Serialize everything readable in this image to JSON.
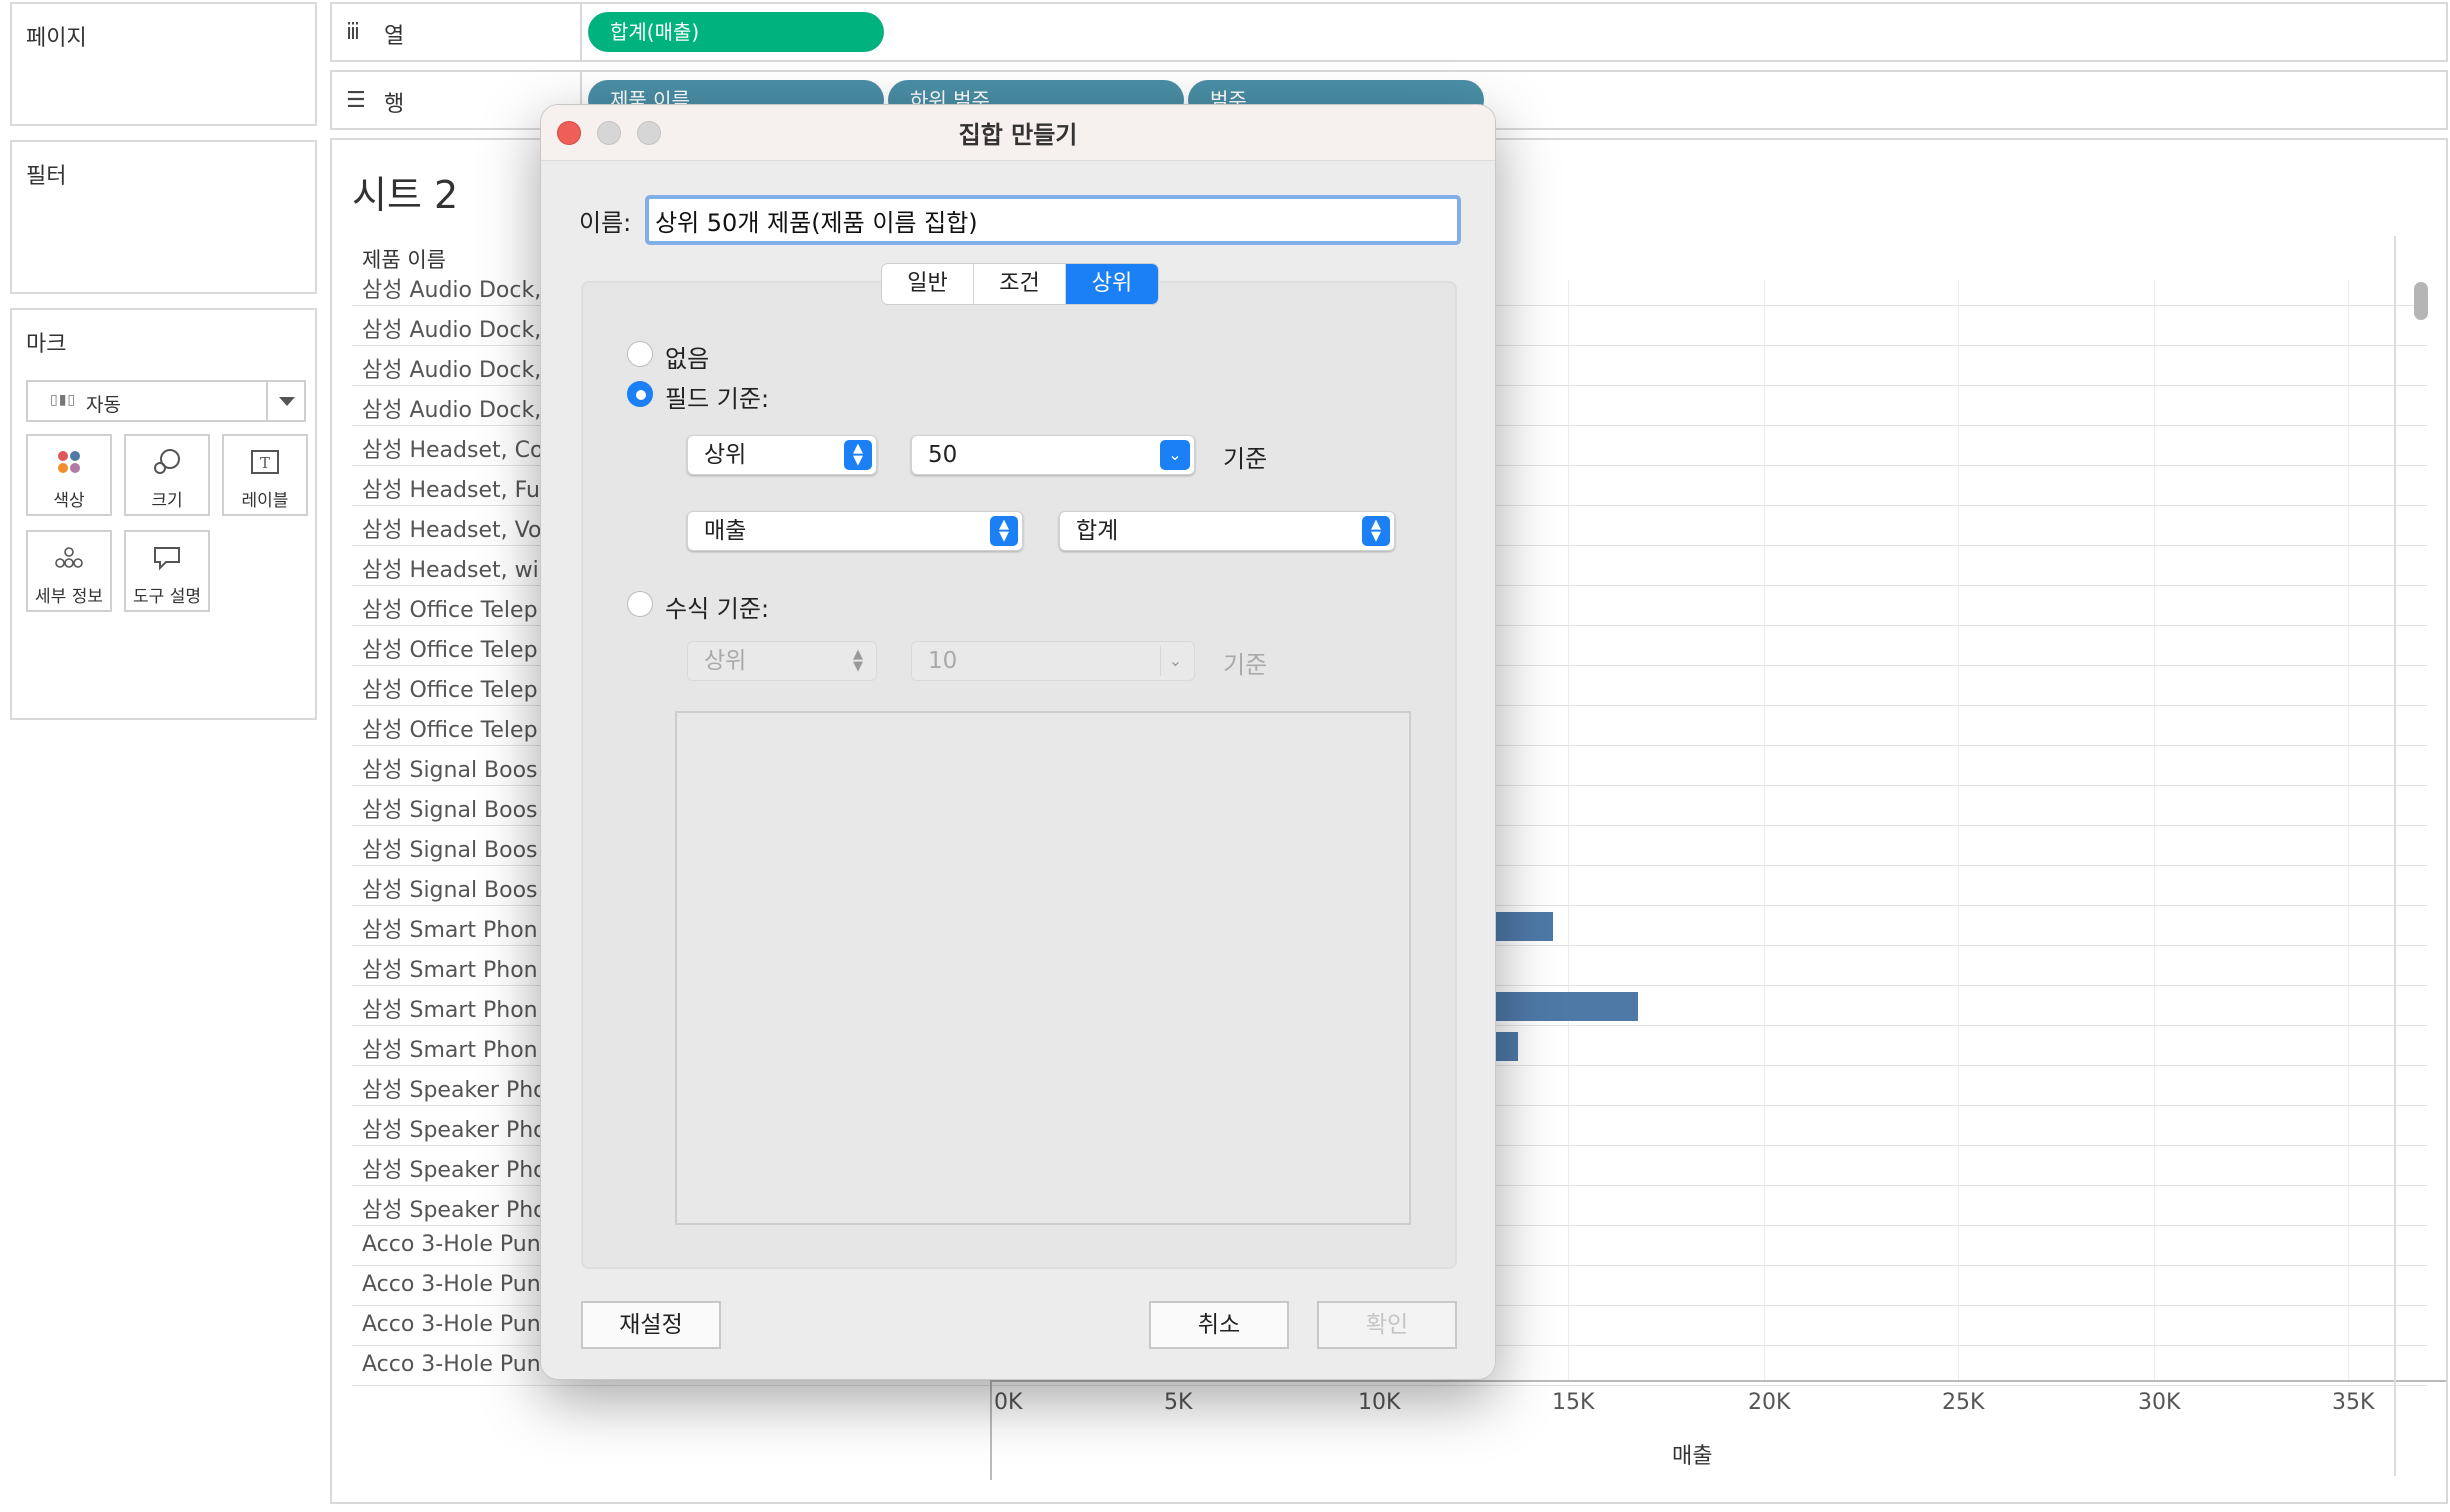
{
  "left_panel": {
    "pages_title": "페이지",
    "filters_title": "필터",
    "marks_title": "마크",
    "mark_type": "자동",
    "mark_buttons": [
      "색상",
      "크기",
      "레이블",
      "세부 정보",
      "도구 설명"
    ]
  },
  "shelves": {
    "columns_label": "열",
    "rows_label": "행",
    "column_pills": [
      "합계(매출)"
    ],
    "row_pills": [
      "제품 이름",
      "하위 범주",
      "범주"
    ]
  },
  "sheet": {
    "title": "시트 2",
    "column_header": "제품 이름",
    "rows": [
      "삼성 Audio Dock,",
      "삼성 Audio Dock,",
      "삼성 Audio Dock,",
      "삼성 Audio Dock,",
      "삼성 Headset, Co",
      "삼성 Headset, Fu",
      "삼성 Headset, Vo",
      "삼성 Headset, wi",
      "삼성 Office Telep",
      "삼성 Office Telep",
      "삼성 Office Telep",
      "삼성 Office Telep",
      "삼성 Signal Boos",
      "삼성 Signal Boos",
      "삼성 Signal Boos",
      "삼성 Signal Boos",
      "삼성 Smart Phon",
      "삼성 Smart Phon",
      "삼성 Smart Phon",
      "삼성 Smart Phon",
      "삼성 Speaker Pho",
      "삼성 Speaker Pho",
      "삼성 Speaker Pho",
      "삼성 Speaker Pho",
      "Acco 3-Hole Pun",
      "Acco 3-Hole Pun",
      "Acco 3-Hole Pun",
      "Acco 3-Hole Pun"
    ],
    "axis_ticks": [
      "0K",
      "5K",
      "10K",
      "15K",
      "20K",
      "25K",
      "30K",
      "35K"
    ],
    "axis_title": "매출",
    "bar_color": "#4e79a7"
  },
  "chart_data": {
    "type": "bar",
    "orientation": "horizontal",
    "xlabel": "매출",
    "xlim": [
      0,
      35000
    ],
    "visible_bars": [
      {
        "row_index": 16,
        "value": 14500
      },
      {
        "row_index": 18,
        "value": 16700
      },
      {
        "row_index": 19,
        "value": 13600
      }
    ]
  },
  "dialog": {
    "title": "집합 만들기",
    "name_label": "이름:",
    "name_value": "상위 50개 제품(제품 이름 집합)",
    "tabs": [
      "일반",
      "조건",
      "상위"
    ],
    "active_tab": "상위",
    "radio_none": "없음",
    "radio_field": "필드 기준:",
    "radio_formula": "수식 기준:",
    "field": {
      "direction": "상위",
      "count": "50",
      "by_label": "기준",
      "measure": "매출",
      "aggregation": "합계"
    },
    "formula": {
      "direction": "상위",
      "count": "10",
      "by_label": "기준"
    },
    "reset_button": "재설정",
    "cancel_button": "취소",
    "ok_button": "확인",
    "accent_color": "#1b7ff5"
  }
}
